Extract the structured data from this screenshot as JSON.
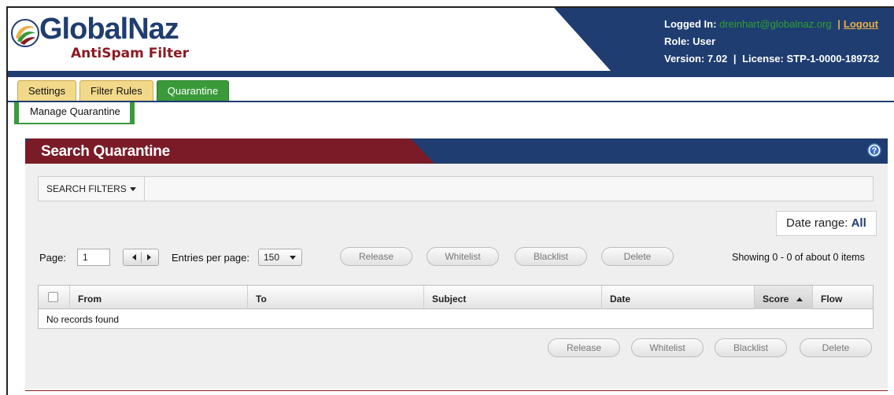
{
  "brand": {
    "name": "GlobalNaz",
    "subtitle": "AntiSpam Filter"
  },
  "user": {
    "logged_in_label": "Logged In:",
    "email": "dreinhart@globalnaz.org",
    "separator": "|",
    "logout": "Logout",
    "role": "Role: User",
    "version": "Version: 7.02",
    "license": "License: STP-1-0000-189732"
  },
  "tabs": [
    {
      "label": "Settings",
      "active": false
    },
    {
      "label": "Filter Rules",
      "active": false
    },
    {
      "label": "Quarantine",
      "active": true
    }
  ],
  "subtab": "Manage Quarantine",
  "panel": {
    "title": "Search Quarantine",
    "help_icon": "question-circle-icon",
    "filters_label": "SEARCH FILTERS",
    "date_range_label": "Date range:",
    "date_range_value": "All"
  },
  "toolbar": {
    "page_label": "Page:",
    "page_value": "1",
    "entries_label": "Entries per page:",
    "entries_value": "150",
    "actions": [
      "Release",
      "Whitelist",
      "Blacklist",
      "Delete"
    ],
    "showing": "Showing 0 - 0 of about 0 items"
  },
  "table": {
    "columns": [
      "From",
      "To",
      "Subject",
      "Date",
      "Score",
      "Flow"
    ],
    "sorted_column": "Score",
    "empty_message": "No records found"
  },
  "colors": {
    "navy": "#1f3d70",
    "maroon": "#7a1b27",
    "green": "#3a9a3a",
    "tab_yellow": "#f2d98a",
    "accent": "#e8b04a"
  }
}
